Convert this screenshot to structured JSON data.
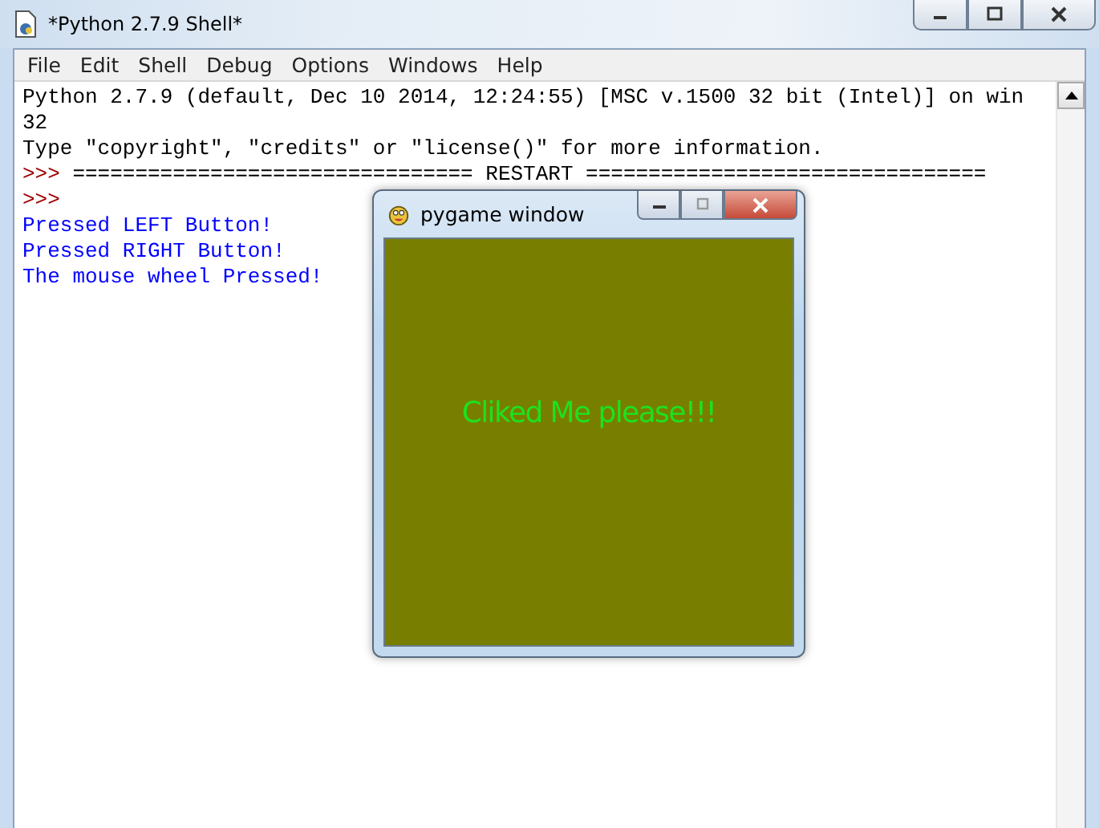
{
  "window": {
    "title": "*Python 2.7.9 Shell*"
  },
  "menu": [
    "File",
    "Edit",
    "Shell",
    "Debug",
    "Options",
    "Windows",
    "Help"
  ],
  "lines": [
    {
      "kind": "output",
      "text": "Python 2.7.9 (default, Dec 10 2014, 12:24:55) [MSC v.1500 32 bit (Intel)] on win"
    },
    {
      "kind": "output",
      "text": "32"
    },
    {
      "kind": "output",
      "text": "Type \"copyright\", \"credits\" or \"license()\" for more information."
    },
    {
      "kind": "output",
      "prompt": ">>>",
      "text": "================================ RESTART ================================"
    },
    {
      "prompt": ">>>"
    },
    {
      "kind": "stdout",
      "text": "Pressed LEFT Button!"
    },
    {
      "kind": "stdout",
      "text": "Pressed RIGHT Button!"
    },
    {
      "kind": "stdout",
      "text": "The mouse wheel Pressed!"
    }
  ],
  "popup": {
    "title": "pygame window",
    "message": "Cliked Me please!!!"
  }
}
